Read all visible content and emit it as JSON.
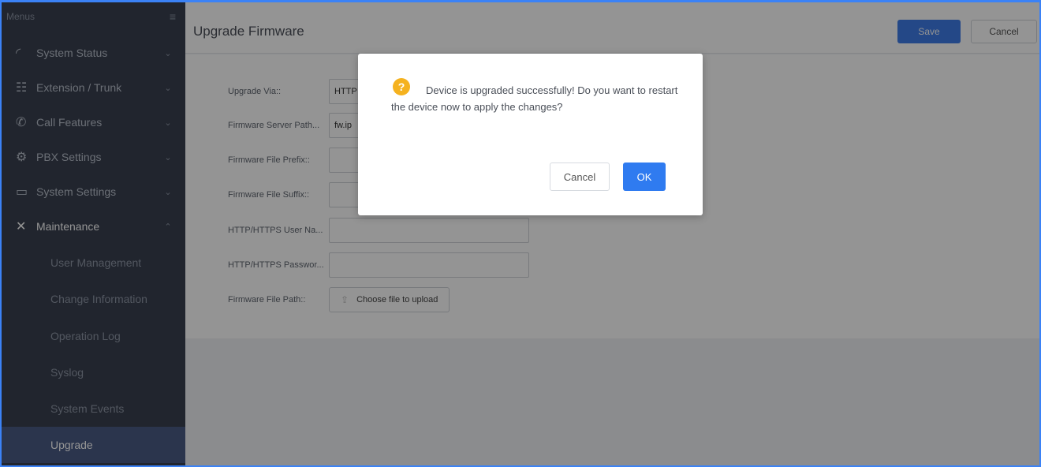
{
  "sidebar": {
    "header": "Menus",
    "collapse_icon": "list-collapse-icon",
    "items": [
      {
        "label": "System Status",
        "icon": "gauge-icon"
      },
      {
        "label": "Extension / Trunk",
        "icon": "network-icon"
      },
      {
        "label": "Call Features",
        "icon": "phone-icon"
      },
      {
        "label": "PBX Settings",
        "icon": "gear-icon"
      },
      {
        "label": "System Settings",
        "icon": "monitor-settings-icon"
      },
      {
        "label": "Maintenance",
        "icon": "tools-icon"
      }
    ],
    "sub_items": [
      {
        "label": "User Management"
      },
      {
        "label": "Change Information"
      },
      {
        "label": "Operation Log"
      },
      {
        "label": "Syslog"
      },
      {
        "label": "System Events"
      },
      {
        "label": "Upgrade"
      }
    ]
  },
  "header": {
    "title": "Upgrade Firmware",
    "save_label": "Save",
    "cancel_label": "Cancel"
  },
  "form": {
    "upgrade_via_label": "Upgrade Via::",
    "upgrade_via_value": "HTTP",
    "server_path_label": "Firmware Server Path...",
    "server_path_value": "fw.ip",
    "prefix_label": "Firmware File Prefix::",
    "suffix_label": "Firmware File Suffix::",
    "username_label": "HTTP/HTTPS User Na...",
    "password_label": "HTTP/HTTPS Passwor...",
    "file_path_label": "Firmware File Path::",
    "upload_label": "Choose file to upload"
  },
  "dialog": {
    "icon": "question-icon",
    "message": "Device is upgraded successfully! Do you want to restart the device now to apply the changes?",
    "cancel_label": "Cancel",
    "ok_label": "OK"
  },
  "colors": {
    "sidebar_bg": "#3a4150",
    "active_item_bg": "#4b5c86",
    "primary": "#2f7bf0",
    "warning": "#f5b21f"
  }
}
